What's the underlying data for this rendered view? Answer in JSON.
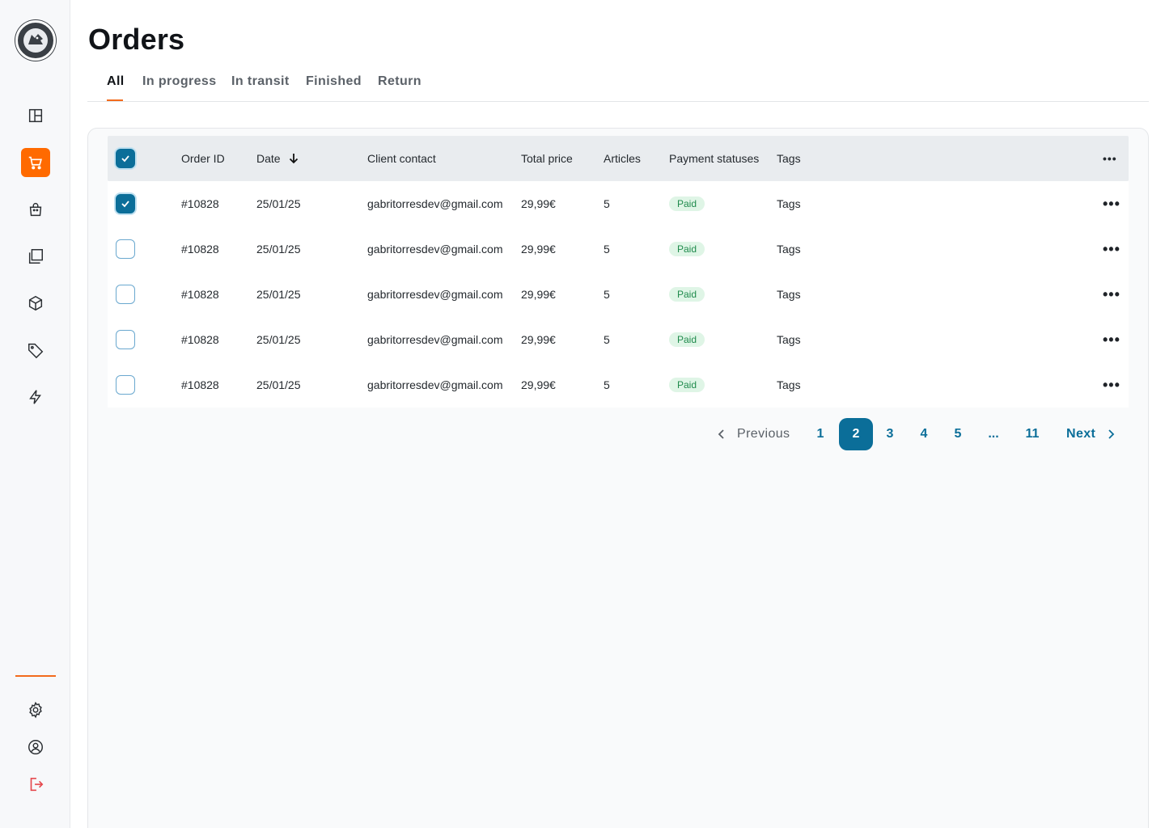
{
  "page": {
    "title": "Orders"
  },
  "tabs": [
    {
      "label": "All",
      "active": true
    },
    {
      "label": "In progress"
    },
    {
      "label": "In transit"
    },
    {
      "label": "Finished"
    },
    {
      "label": "Return"
    }
  ],
  "table": {
    "headers": {
      "order_id": "Order ID",
      "date": "Date",
      "client_contact": "Client contact",
      "total_price": "Total price",
      "articles": "Articles",
      "payment_statuses": "Payment statuses",
      "tags": "Tags",
      "more": "•••"
    },
    "rows": [
      {
        "checked": true,
        "order_id": "#10828",
        "date": "25/01/25",
        "client": "gabritorresdev@gmail.com",
        "price": "29,99€",
        "articles": "5",
        "status": "Paid",
        "tags": "Tags"
      },
      {
        "checked": false,
        "order_id": "#10828",
        "date": "25/01/25",
        "client": "gabritorresdev@gmail.com",
        "price": "29,99€",
        "articles": "5",
        "status": "Paid",
        "tags": "Tags"
      },
      {
        "checked": false,
        "order_id": "#10828",
        "date": "25/01/25",
        "client": "gabritorresdev@gmail.com",
        "price": "29,99€",
        "articles": "5",
        "status": "Paid",
        "tags": "Tags"
      },
      {
        "checked": false,
        "order_id": "#10828",
        "date": "25/01/25",
        "client": "gabritorresdev@gmail.com",
        "price": "29,99€",
        "articles": "5",
        "status": "Paid",
        "tags": "Tags"
      },
      {
        "checked": false,
        "order_id": "#10828",
        "date": "25/01/25",
        "client": "gabritorresdev@gmail.com",
        "price": "29,99€",
        "articles": "5",
        "status": "Paid",
        "tags": "Tags"
      }
    ],
    "more_label": "•••"
  },
  "pagination": {
    "previous": "Previous",
    "next": "Next",
    "pages": [
      "1",
      "2",
      "3",
      "4",
      "5",
      "...",
      "11"
    ],
    "current": "2"
  },
  "sidebar": {
    "items": [
      {
        "icon": "dashboard-icon"
      },
      {
        "icon": "cart-icon",
        "active": true
      },
      {
        "icon": "bag-icon"
      },
      {
        "icon": "collection-icon"
      },
      {
        "icon": "box-icon"
      },
      {
        "icon": "tag-icon"
      },
      {
        "icon": "bolt-icon"
      }
    ],
    "bottom": [
      {
        "icon": "gear-icon"
      },
      {
        "icon": "user-icon"
      },
      {
        "icon": "logout-icon"
      }
    ]
  },
  "colors": {
    "accent": "#ff6a00",
    "primary": "#0b6e99",
    "paid_bg": "#dff5e6",
    "paid_text": "#1f8a4c",
    "logout": "#e5484d"
  }
}
